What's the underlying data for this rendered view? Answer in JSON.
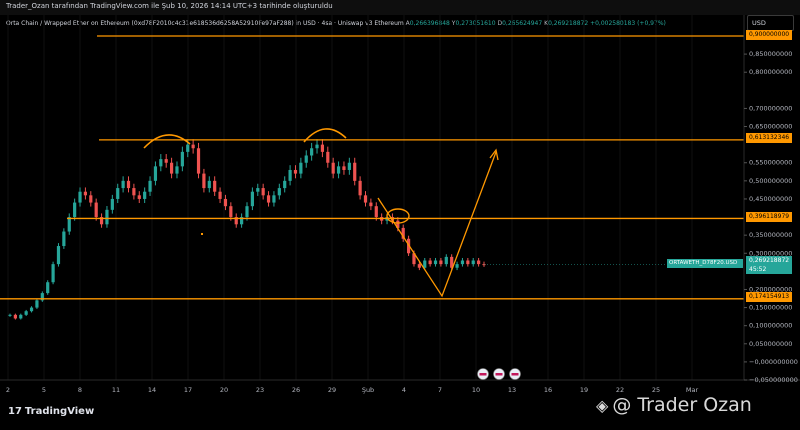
{
  "header": {
    "snapshot_text": "Trader_Ozan tarafından TradingView.com ile Şub 10, 2026 14:14 UTC+3 tarihinde oluşturuldu"
  },
  "legend": {
    "symbol": "Orta Chain / Wrapped Ether on Ethereum (0xd78F2010c4c31e618536d6258A52910Fe97aF288) in USD · 4sa · Uniswap v3 Ethereum",
    "o_key": "A",
    "o_val": "0,266396848",
    "h_key": "Y",
    "h_val": "0,273051610",
    "l_key": "D",
    "l_val": "0,265624947",
    "c_key": "K",
    "c_val": "0,269218872",
    "change": "+0,002580183 (+0,97%)"
  },
  "toolbar": {
    "currency_label": "USD"
  },
  "price_axis": {
    "labels": [
      "0,850000000",
      "0,800000000",
      "0,700000000",
      "0,650000000",
      "0,550000000",
      "0,500000000",
      "0,450000000",
      "0,350000000",
      "0,300000000",
      "0,200000000",
      "0,150000000",
      "0,100000000",
      "0,050000000",
      "−0,000000000",
      "−0,050000000"
    ]
  },
  "time_axis": {
    "labels": [
      "2",
      "5",
      "8",
      "11",
      "14",
      "17",
      "20",
      "23",
      "26",
      "29",
      "Şub",
      "4",
      "7",
      "10",
      "13",
      "16",
      "19",
      "22",
      "25",
      "Mar"
    ]
  },
  "levels": {
    "top": "0,900000000",
    "resistance": "0,613132346",
    "middle": "0,396118979",
    "support": "0,174154913"
  },
  "current": {
    "symbol_tag": "ORTAWETH_D78F20.USD",
    "price": "0,269218872",
    "countdown": "45:52"
  },
  "branding": {
    "logo_text": "TradingView",
    "watermark_text": "@ Trader Ozan"
  },
  "colors": {
    "up": "#26a69a",
    "down": "#ef5350",
    "drawing": "#ff9800",
    "background": "#000000"
  },
  "chart_data": {
    "type": "candlestick",
    "y_range": [
      -0.05,
      0.9
    ],
    "x_labels": [
      "2",
      "5",
      "8",
      "11",
      "14",
      "17",
      "20",
      "23",
      "26",
      "29",
      "Şub",
      "4",
      "7",
      "10",
      "13",
      "16",
      "19",
      "22",
      "25",
      "Mar"
    ],
    "closes": [
      0.13,
      0.12,
      0.13,
      0.14,
      0.15,
      0.17,
      0.19,
      0.22,
      0.27,
      0.32,
      0.36,
      0.4,
      0.44,
      0.47,
      0.46,
      0.44,
      0.4,
      0.38,
      0.42,
      0.45,
      0.48,
      0.5,
      0.48,
      0.46,
      0.45,
      0.47,
      0.5,
      0.54,
      0.56,
      0.55,
      0.52,
      0.54,
      0.58,
      0.6,
      0.59,
      0.52,
      0.48,
      0.5,
      0.47,
      0.45,
      0.43,
      0.4,
      0.38,
      0.4,
      0.43,
      0.47,
      0.48,
      0.46,
      0.44,
      0.46,
      0.48,
      0.5,
      0.53,
      0.52,
      0.55,
      0.57,
      0.59,
      0.6,
      0.58,
      0.55,
      0.52,
      0.54,
      0.53,
      0.55,
      0.5,
      0.46,
      0.44,
      0.43,
      0.4,
      0.39,
      0.4,
      0.39,
      0.37,
      0.34,
      0.3,
      0.27,
      0.26,
      0.28,
      0.27,
      0.28,
      0.27,
      0.29,
      0.26,
      0.27,
      0.28,
      0.27,
      0.28,
      0.27,
      0.269
    ],
    "drawings": {
      "horizontal_levels": [
        0.9,
        0.613132346,
        0.396118979,
        0.174154913
      ],
      "projection": [
        [
          7.0,
          0.174
        ],
        [
          8.7,
          0.58
        ]
      ]
    }
  }
}
